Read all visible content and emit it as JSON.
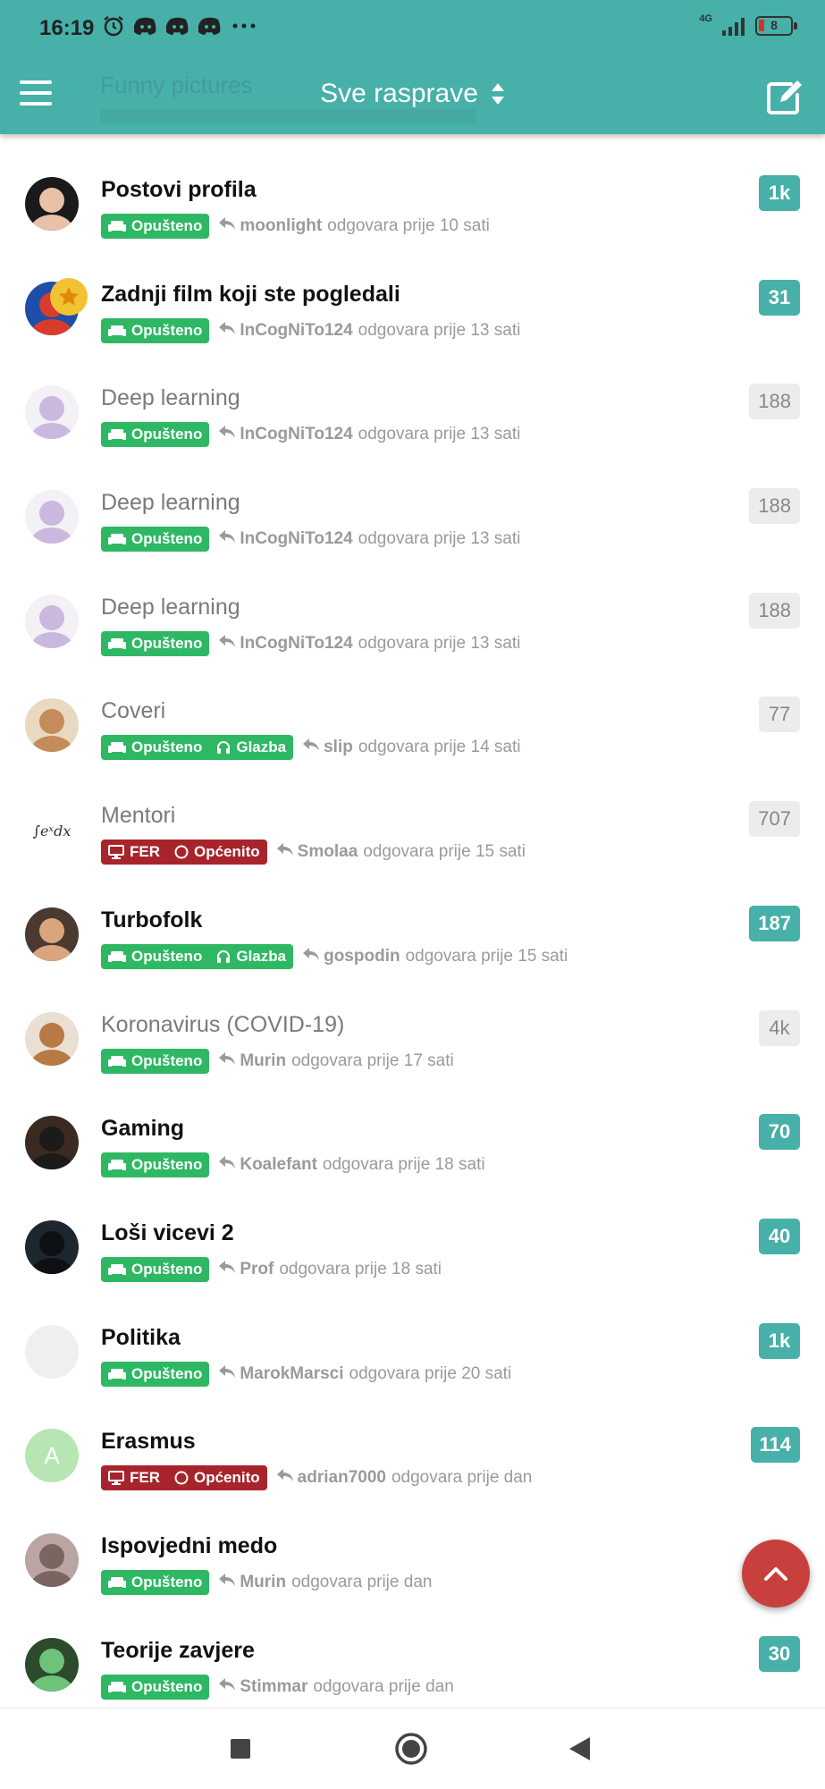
{
  "status_bar": {
    "time": "16:19",
    "network": "4G",
    "battery": "8"
  },
  "header": {
    "ghost_text": "Funny pictures",
    "title": "Sve rasprave",
    "menu_icon": "hamburger-icon",
    "compose_icon": "compose-icon",
    "sort_icon": "sort-updown-icon",
    "background_color": "#47b0a8"
  },
  "colors": {
    "accent": "#47b0a8",
    "tag_green": "#2fb864",
    "tag_red": "#a8242c",
    "fab": "#c8403d"
  },
  "threads": [
    {
      "title": "Postovi profila",
      "unread": true,
      "tags": [
        "Opušteno"
      ],
      "tag_color": "green",
      "user": "moonlight",
      "text": "odgovara prije 10 sati",
      "count": "1k"
    },
    {
      "title": "Zadnji film koji ste pogledali",
      "unread": true,
      "tags": [
        "Opušteno"
      ],
      "tag_color": "green",
      "user": "InCogNiTo124",
      "text": "odgovara prije 13 sati",
      "count": "31",
      "starred": true
    },
    {
      "title": "Deep learning",
      "unread": false,
      "tags": [
        "Opušteno"
      ],
      "tag_color": "green",
      "user": "InCogNiTo124",
      "text": "odgovara prije 13 sati",
      "count": "188"
    },
    {
      "title": "Deep learning",
      "unread": false,
      "tags": [
        "Opušteno"
      ],
      "tag_color": "green",
      "user": "InCogNiTo124",
      "text": "odgovara prije 13 sati",
      "count": "188"
    },
    {
      "title": "Deep learning",
      "unread": false,
      "tags": [
        "Opušteno"
      ],
      "tag_color": "green",
      "user": "InCogNiTo124",
      "text": "odgovara prije 13 sati",
      "count": "188"
    },
    {
      "title": "Coveri",
      "unread": false,
      "tags": [
        "Opušteno",
        "Glazba"
      ],
      "tag_color": "green",
      "user": "slip",
      "text": "odgovara prije 14 sati",
      "count": "77"
    },
    {
      "title": "Mentori",
      "unread": false,
      "tags": [
        "FER",
        "Općenito"
      ],
      "tag_color": "red",
      "user": "Smolaa",
      "text": "odgovara prije 15 sati",
      "count": "707"
    },
    {
      "title": "Turbofolk",
      "unread": true,
      "tags": [
        "Opušteno",
        "Glazba"
      ],
      "tag_color": "green",
      "user": "gospodin",
      "text": "odgovara prije 15 sati",
      "count": "187"
    },
    {
      "title": "Koronavirus (COVID-19)",
      "unread": false,
      "tags": [
        "Opušteno"
      ],
      "tag_color": "green",
      "user": "Murin",
      "text": "odgovara prije 17 sati",
      "count": "4k"
    },
    {
      "title": "Gaming",
      "unread": true,
      "tags": [
        "Opušteno"
      ],
      "tag_color": "green",
      "user": "Koalefant",
      "text": "odgovara prije 18 sati",
      "count": "70"
    },
    {
      "title": "Loši vicevi 2",
      "unread": true,
      "tags": [
        "Opušteno"
      ],
      "tag_color": "green",
      "user": "Prof",
      "text": "odgovara prije 18 sati",
      "count": "40"
    },
    {
      "title": "Politika",
      "unread": true,
      "tags": [
        "Opušteno"
      ],
      "tag_color": "green",
      "user": "MarokMarsci",
      "text": "odgovara prije 20 sati",
      "count": "1k"
    },
    {
      "title": "Erasmus",
      "unread": true,
      "tags": [
        "FER",
        "Općenito"
      ],
      "tag_color": "red",
      "user": "adrian7000",
      "text": "odgovara prije dan",
      "count": "114",
      "avatar_letter": "A"
    },
    {
      "title": "Ispovjedni medo",
      "unread": true,
      "tags": [
        "Opušteno"
      ],
      "tag_color": "green",
      "user": "Murin",
      "text": "odgovara prije dan",
      "count": ""
    },
    {
      "title": "Teorije zavjere",
      "unread": true,
      "tags": [
        "Opušteno"
      ],
      "tag_color": "green",
      "user": "Stimmar",
      "text": "odgovara prije dan",
      "count": "30"
    }
  ],
  "fab": {
    "icon": "chevron-up-icon"
  },
  "nav_bar": {
    "recent_icon": "recent-apps-icon",
    "home_icon": "home-icon",
    "back_icon": "back-icon"
  }
}
